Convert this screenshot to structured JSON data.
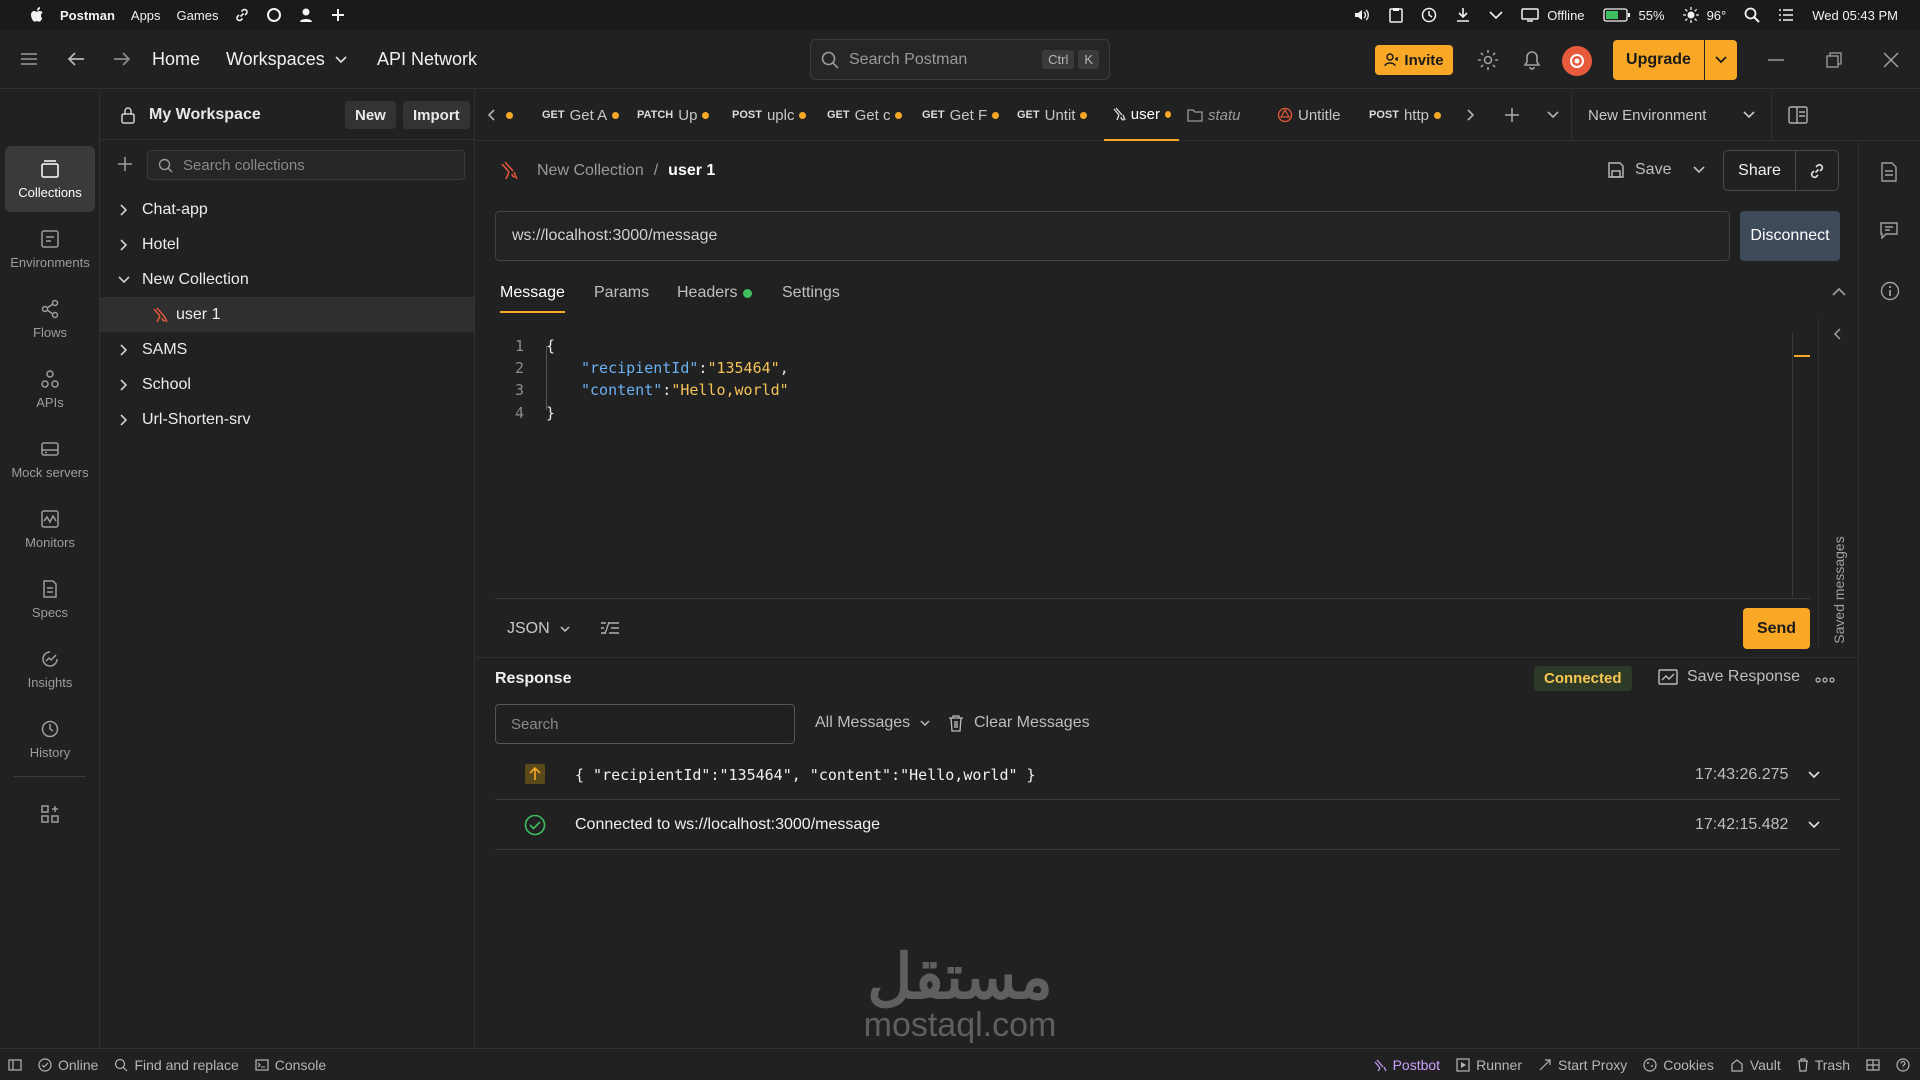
{
  "macbar": {
    "app": "Postman",
    "menus": [
      "Apps",
      "Games"
    ],
    "offline": "Offline",
    "battery": "55%",
    "temperature": "96°",
    "clock": "Wed 05:43 PM"
  },
  "header": {
    "home": "Home",
    "workspaces": "Workspaces",
    "api_network": "API Network",
    "search_placeholder": "Search Postman",
    "kbd1": "Ctrl",
    "kbd2": "K",
    "invite": "Invite",
    "upgrade": "Upgrade"
  },
  "rail": {
    "items": [
      {
        "label": "Collections",
        "icon": "collections-icon"
      },
      {
        "label": "Environments",
        "icon": "environments-icon"
      },
      {
        "label": "Flows",
        "icon": "flows-icon"
      },
      {
        "label": "APIs",
        "icon": "apis-icon"
      },
      {
        "label": "Mock servers",
        "icon": "mock-servers-icon"
      },
      {
        "label": "Monitors",
        "icon": "monitors-icon"
      },
      {
        "label": "Specs",
        "icon": "specs-icon"
      },
      {
        "label": "Insights",
        "icon": "insights-icon"
      },
      {
        "label": "History",
        "icon": "history-icon"
      }
    ]
  },
  "sidebar": {
    "workspace": "My Workspace",
    "new": "New",
    "import": "Import",
    "search_placeholder": "Search collections",
    "collections": [
      "Chat-app",
      "Hotel",
      "New Collection",
      "user 1",
      "SAMS",
      "School",
      "Url-Shorten-srv"
    ]
  },
  "tabs": [
    {
      "method": "GET",
      "label": "Get A"
    },
    {
      "method": "PATCH",
      "label": "Up"
    },
    {
      "method": "POST",
      "label": "uplc"
    },
    {
      "method": "GET",
      "label": "Get c"
    },
    {
      "method": "GET",
      "label": "Get F"
    },
    {
      "method": "GET",
      "label": "Untit"
    },
    {
      "method": "",
      "label": "user"
    },
    {
      "method": "",
      "label": "statu"
    },
    {
      "method": "",
      "label": "Untitle"
    },
    {
      "method": "POST",
      "label": "http"
    }
  ],
  "environment": "New Environment",
  "breadcrumb": {
    "collection": "New Collection",
    "sep": "/",
    "request": "user 1"
  },
  "actions": {
    "save": "Save",
    "share": "Share",
    "disconnect": "Disconnect",
    "send": "Send"
  },
  "url": "ws://localhost:3000/message",
  "subtabs": [
    "Message",
    "Params",
    "Headers",
    "Settings"
  ],
  "code": {
    "line_numbers": [
      "1",
      "2",
      "3",
      "4"
    ],
    "open": "{",
    "key1": "\"recipientId\"",
    "val1": "\"135464\"",
    "key2": "\"content\"",
    "val2": "\"Hello,world\"",
    "close": "}",
    "colon": ":",
    "comma": ","
  },
  "format": "JSON",
  "saved_messages": "Saved messages",
  "response": {
    "title": "Response",
    "status": "Connected",
    "save_response": "Save Response",
    "search_placeholder": "Search",
    "filter": "All Messages",
    "clear": "Clear Messages",
    "messages": [
      {
        "text": "{ \"recipientId\":\"135464\", \"content\":\"Hello,world\" }",
        "time": "17:43:26.275"
      },
      {
        "text": "Connected to ws://localhost:3000/message",
        "time": "17:42:15.482"
      }
    ]
  },
  "watermark": {
    "arabic": "مستقل",
    "latin": "mostaql.com"
  },
  "statusbar": {
    "online": "Online",
    "find": "Find and replace",
    "console": "Console",
    "postbot": "Postbot",
    "runner": "Runner",
    "proxy": "Start Proxy",
    "cookies": "Cookies",
    "vault": "Vault",
    "trash": "Trash"
  },
  "colors": {
    "accent": "#f9a825",
    "bg": "#212121",
    "connected": "#f9c74f",
    "check": "#3fbf5f"
  }
}
